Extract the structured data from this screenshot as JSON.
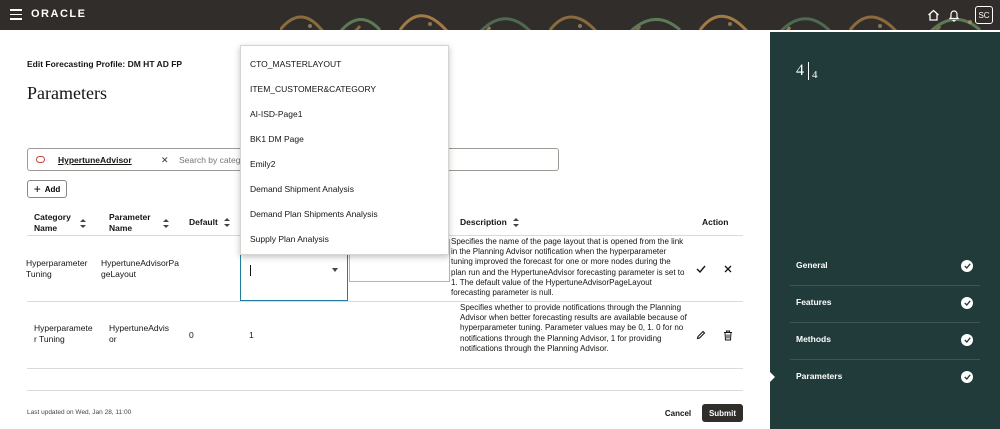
{
  "header": {
    "logo": "ORACLE",
    "avatar_initials": "SC",
    "icons": [
      "hamburger-icon",
      "home-icon",
      "bell-icon"
    ]
  },
  "page": {
    "profile_title": "Edit Forecasting Profile: DM HT AD FP",
    "title": "Parameters"
  },
  "search": {
    "chip_label": "HypertuneAdvisor",
    "placeholder": "Search by category, parameter name, or description"
  },
  "toolbar": {
    "add_label": "Add"
  },
  "table": {
    "headers": {
      "category": "Category Name",
      "parameter": "Parameter Name",
      "default": "Default",
      "description": "Description",
      "action": "Action"
    },
    "rows": [
      {
        "category": "Hyperparameter Tuning",
        "parameter": "HypertuneAdvisorPageLayout",
        "default": "",
        "value": "",
        "description": "Specifies the name of the page layout that is opened from the link in the Planning Advisor notification when the hyperparameter tuning improved the forecast for one or more nodes during the plan run and the HypertuneAdvisor forecasting parameter is set to 1. The default value of the HypertuneAdvisorPageLayout forecasting parameter is null."
      },
      {
        "category": "Hyperparameter Tuning",
        "parameter": "HypertuneAdvisor",
        "default": "0",
        "value": "1",
        "description": "Specifies whether to provide notifications through the Planning Advisor when better forecasting results are available because of hyperparameter tuning. Parameter values may be 0, 1. 0 for no notifications through the Planning Advisor, 1 for providing notifications through the Planning Advisor."
      }
    ]
  },
  "dropdown": {
    "options": [
      "CTO_MASTERLAYOUT",
      "ITEM_CUSTOMER&CATEGORY",
      "AI-ISD-Page1",
      "BK1 DM Page",
      "Emily2",
      "Demand Shipment Analysis",
      "Demand Plan Shipments Analysis",
      "Supply Plan Analysis"
    ]
  },
  "footer": {
    "last_updated": "Last updated on Wed, Jan 28, 11:00",
    "cancel_label": "Cancel",
    "submit_label": "Submit"
  },
  "train": {
    "current": "4",
    "total": "4",
    "steps": [
      {
        "label": "General",
        "status": "complete"
      },
      {
        "label": "Features",
        "status": "complete"
      },
      {
        "label": "Methods",
        "status": "complete"
      },
      {
        "label": "Parameters",
        "status": "complete"
      }
    ]
  },
  "colors": {
    "header_bg": "#312d2a",
    "panel_bg": "#213b3a",
    "focus_border": "#227e9e",
    "chip_icon": "#c74634"
  }
}
